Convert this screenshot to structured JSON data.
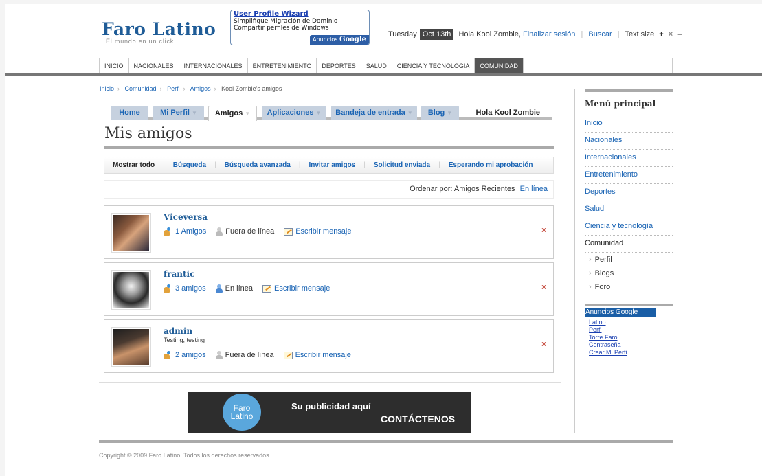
{
  "logo": {
    "title": "Faro Latino",
    "tagline": "El mundo en un click"
  },
  "ad": {
    "title": "User Profile Wizard",
    "line1": "Simplifique Migración de Dominio",
    "line2": "Compartir perfiles de Windows",
    "brand_prefix": "Anuncios",
    "brand_name": "Google"
  },
  "topbar": {
    "day": "Tuesday",
    "date": "Oct 13th",
    "greeting": "Hola Kool Zombie,",
    "logout": "Finalizar sesión",
    "search": "Buscar",
    "text_size": "Text size",
    "increase": "+",
    "reset": "×",
    "decrease": "–"
  },
  "nav": [
    "INICIO",
    "NACIONALES",
    "INTERNACIONALES",
    "ENTRETENIMIENTO",
    "DEPORTES",
    "SALUD",
    "CIENCIA Y TECNOLOGÍA",
    "COMUNIDAD"
  ],
  "breadcrumb": [
    "Inicio",
    "Comunidad",
    "Perfi",
    "Amigos",
    "Kool Zombie's amigos"
  ],
  "tabs": [
    "Home",
    "Mi Perfil",
    "Amigos",
    "Aplicaciones",
    "Bandeja de entrada",
    "Blog"
  ],
  "hello": "Hola Kool Zombie",
  "page_title": "Mis amigos",
  "subnav": [
    "Mostrar todo",
    "Búsqueda",
    "Búsqueda avanzada",
    "Invitar amigos",
    "Solicitud enviada",
    "Esperando mi aprobación"
  ],
  "sort": {
    "label": "Ordenar por:",
    "recent": "Amigos Recientes",
    "online": "En línea"
  },
  "friends": [
    {
      "name": "Viceversa",
      "status": "",
      "count": "1 Amigos",
      "presence": "Fuera de línea",
      "message": "Escribir mensaje",
      "remove": "×"
    },
    {
      "name": "frantic",
      "status": "",
      "count": "3 amigos",
      "presence": "En línea",
      "message": "Escribir mensaje",
      "remove": "×"
    },
    {
      "name": "admin",
      "status": "Testing, testing",
      "count": "2 amigos",
      "presence": "Fuera de línea",
      "message": "Escribir mensaje",
      "remove": "×"
    }
  ],
  "banner": {
    "badge_line1": "Faro",
    "badge_line2": "Latino",
    "text1": "Su publicidad aquí",
    "text2": "CONTÁCTENOS"
  },
  "sidebar": {
    "title": "Menú principal",
    "items": [
      "Inicio",
      "Nacionales",
      "Internacionales",
      "Entretenimiento",
      "Deportes",
      "Salud",
      "Ciencia y tecnología",
      "Comunidad"
    ],
    "subitems": [
      "Perfil",
      "Blogs",
      "Foro"
    ],
    "google_head": "Anuncios Google",
    "google_links": [
      "Latino",
      "Perfi",
      "Torre Faro",
      "Contraseña",
      "Crear Mi Perfi"
    ]
  },
  "footer": {
    "copyright": "Copyright © 2009 Faro Latino. Todos los derechos reservados."
  },
  "colors": {
    "brand": "#1f5c97",
    "link": "#1a64b4",
    "tab_bg": "#c6d1df",
    "remove": "#c0392b"
  }
}
